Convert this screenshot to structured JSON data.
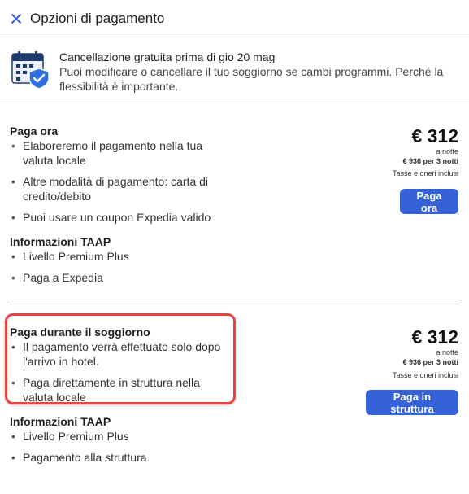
{
  "header": {
    "title": "Opzioni di pagamento"
  },
  "banner": {
    "title": "Cancellazione gratuita prima di gio 20 mag",
    "text": "Puoi modificare o cancellare il tuo soggiorno se cambi programmi. Perché la flessibilità è importante."
  },
  "pay_now": {
    "title": "Paga ora",
    "bullets": [
      "Elaboreremo il pagamento nella tua valuta locale",
      "Altre modalità di pagamento: carta di credito/debito",
      "Puoi usare un coupon Expedia valido"
    ],
    "info_title": "Informazioni TAAP",
    "info_bullets": [
      "Livello Premium Plus",
      "Paga a Expedia"
    ],
    "price": "€ 312",
    "per_night": "a notte",
    "total": "€ 936 per 3 notti",
    "taxes": "Tasse e oneri inclusi",
    "button": "Paga ora"
  },
  "pay_later": {
    "title": "Paga durante il soggiorno",
    "bullets": [
      "Il pagamento verrà effettuato solo dopo l'arrivo in hotel.",
      "Paga direttamente in struttura nella valuta locale"
    ],
    "info_title": "Informazioni TAAP",
    "info_bullets": [
      "Livello Premium Plus",
      "Pagamento alla struttura"
    ],
    "price": "€ 312",
    "per_night": "a notte",
    "total": "€ 936 per 3 notti",
    "taxes": "Tasse e oneri inclusi",
    "button": "Paga in struttura"
  },
  "colors": {
    "accent": "#3662d8",
    "highlight": "#e64343"
  },
  "icons": {
    "close": "close-icon",
    "banner": "calendar-shield-icon"
  }
}
